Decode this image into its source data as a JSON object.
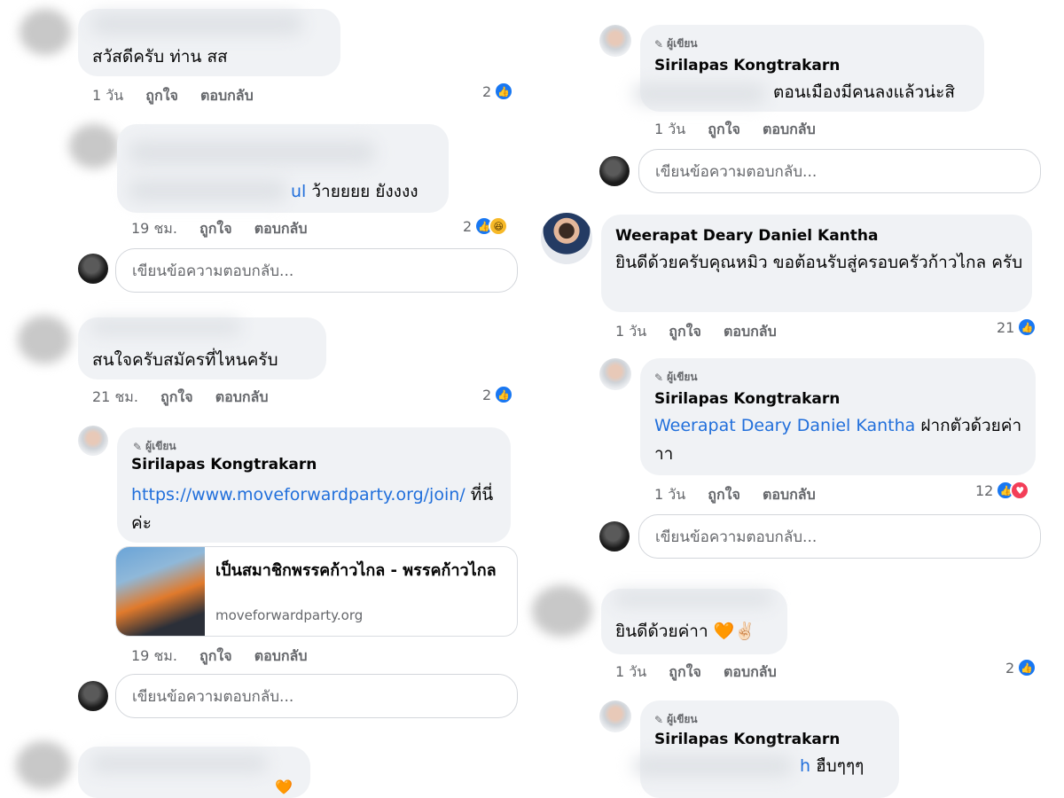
{
  "strings": {
    "like": "ถูกใจ",
    "reply": "ตอบกลับ",
    "reply_placeholder": "เขียนข้อความตอบกลับ...",
    "author_badge": "ผู้เขียน"
  },
  "left": {
    "c1": {
      "text": "สวัสดีครับ ท่าน สส",
      "time": "1 วัน",
      "reactions": "2"
    },
    "c2": {
      "text_link": "ul",
      "text": " ว้ายยยย ยังงงง",
      "time": "19 ชม.",
      "reactions": "2"
    },
    "c3": {
      "name_partial": "Kapong ...",
      "text": "สนใจครับสมัครที่ไหนครับ",
      "time": "21 ชม.",
      "reactions": "2"
    },
    "r1": {
      "name": "Sirilapas Kongtrakarn",
      "link": "https://www.moveforwardparty.org/join/",
      "text": " ที่นี่ค่ะ",
      "preview_title": "เป็นสมาชิกพรรคก้าวไกล - พรรคก้าวไกล",
      "preview_domain": "moveforwardparty.org",
      "time": "19 ชม."
    }
  },
  "right": {
    "r0": {
      "name": "Sirilapas Kongtrakarn",
      "text": "ตอนเมืองมีคนลงแล้วน่ะสิ",
      "time": "1 วัน"
    },
    "c4": {
      "name": "Weerapat Deary Daniel Kantha",
      "text": "ยินดีด้วยครับคุณหมิว ขอต้อนรับสู่ครอบครัวก้าวไกล ครับ",
      "time": "1 วัน",
      "reactions": "21"
    },
    "r2": {
      "name": "Sirilapas Kongtrakarn",
      "mention": "Weerapat Deary Daniel Kantha",
      "text": " ฝากตัวด้วยค่าาา",
      "time": "1 วัน",
      "reactions": "12"
    },
    "c5": {
      "name_partial": "...a Kongtrakarn",
      "text": "ยินดีด้วยค่าา 🧡✌🏻",
      "time": "1 วัน",
      "reactions": "2"
    },
    "r3": {
      "name": "Sirilapas Kongtrakarn",
      "text_link": "h",
      "text": " ฮืบๆๆๆ"
    }
  },
  "colors": {
    "link": "#216fdb",
    "bubble": "#f0f2f5",
    "like": "#1877f2",
    "meta": "#65676b"
  }
}
